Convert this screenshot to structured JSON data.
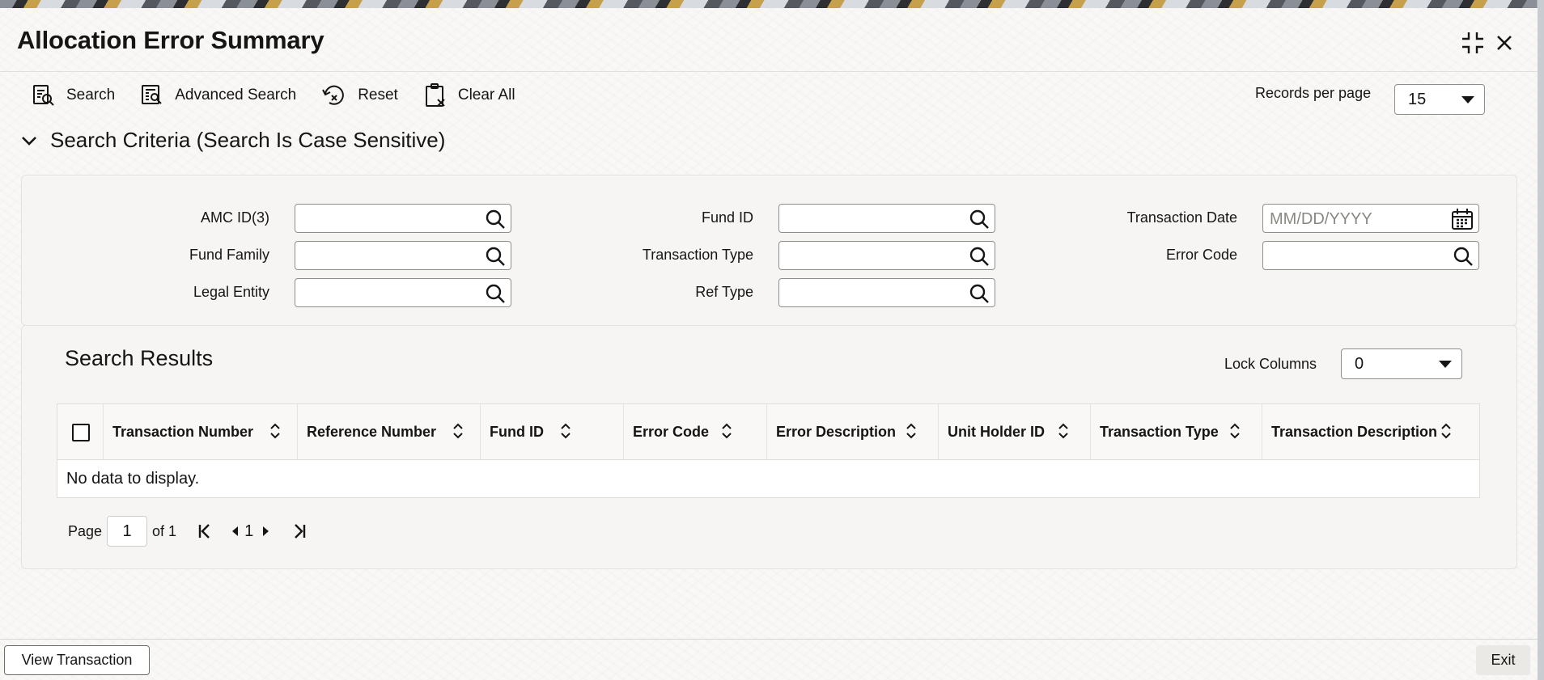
{
  "window": {
    "title": "Allocation Error Summary"
  },
  "icons": {
    "maximize": "collapse-corners-icon",
    "close": "close-icon"
  },
  "toolbar": {
    "search_label": "Search",
    "advanced_search_label": "Advanced Search",
    "reset_label": "Reset",
    "clear_all_label": "Clear All",
    "records_per_page_label": "Records per page",
    "records_per_page_value": "15"
  },
  "criteria": {
    "header": "Search Criteria (Search Is Case Sensitive)",
    "fields": {
      "amc_id": {
        "label": "AMC ID(3)",
        "value": ""
      },
      "fund_family": {
        "label": "Fund Family",
        "value": ""
      },
      "legal_entity": {
        "label": "Legal Entity",
        "value": ""
      },
      "fund_id": {
        "label": "Fund ID",
        "value": ""
      },
      "transaction_type": {
        "label": "Transaction Type",
        "value": ""
      },
      "ref_type": {
        "label": "Ref Type",
        "value": ""
      },
      "transaction_date": {
        "label": "Transaction Date",
        "placeholder": "MM/DD/YYYY"
      },
      "error_code": {
        "label": "Error Code",
        "value": ""
      }
    }
  },
  "results": {
    "title": "Search Results",
    "lock_columns_label": "Lock Columns",
    "lock_columns_value": "0",
    "columns": [
      "Transaction Number",
      "Reference Number",
      "Fund ID",
      "Error Code",
      "Error Description",
      "Unit Holder ID",
      "Transaction Type",
      "Transaction Description"
    ],
    "empty_message": "No data to display."
  },
  "pagination": {
    "page_label": "Page",
    "current_page": "1",
    "of_label": "of 1",
    "page_number": "1"
  },
  "footer": {
    "view_transaction_label": "View Transaction",
    "exit_label": "Exit"
  }
}
